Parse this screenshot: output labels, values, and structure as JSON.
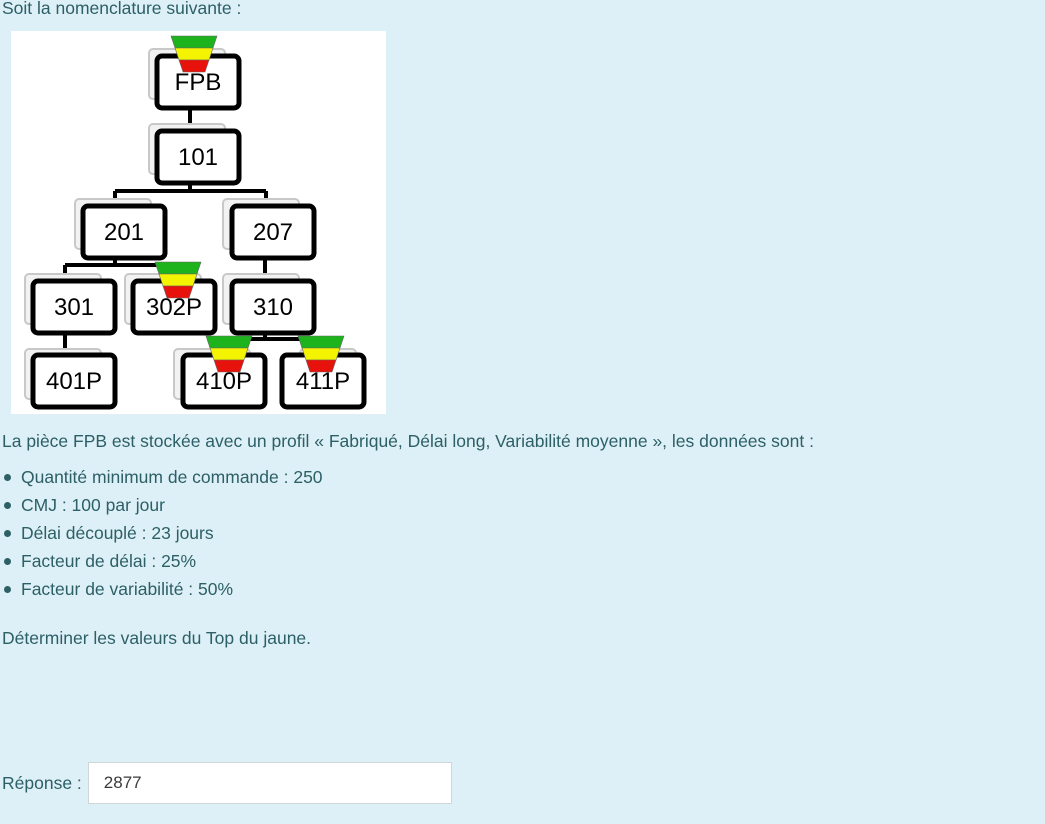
{
  "intro": "Soit la nomenclature suivante :",
  "bom": {
    "nodes": {
      "fpb": "FPB",
      "n101": "101",
      "n201": "201",
      "n207": "207",
      "n301": "301",
      "n302p": "302P",
      "n310": "310",
      "n401p": "401P",
      "n410p": "410P",
      "n411p": "411P"
    },
    "buffer_colors": {
      "green": "#1db31d",
      "yellow": "#f4f400",
      "red": "#e8120c"
    }
  },
  "description": "La pièce FPB est stockée avec un profil « Fabriqué, Délai long, Variabilité moyenne », les données sont :",
  "data_items": [
    "Quantité minimum de commande : 250",
    "CMJ : 100 par jour",
    "Délai découplé : 23 jours",
    "Facteur de délai : 25%",
    "Facteur de variabilité : 50%"
  ],
  "question": "Déterminer les valeurs du Top du jaune.",
  "answer": {
    "label": "Réponse :",
    "value": "2877"
  }
}
